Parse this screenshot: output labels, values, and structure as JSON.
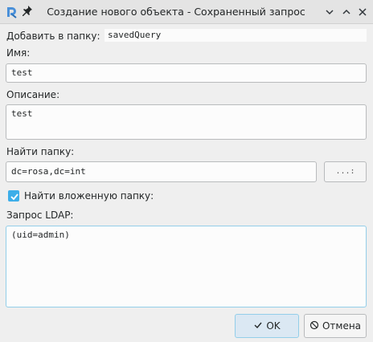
{
  "window": {
    "title": "Создание нового объекта - Сохраненный запрос"
  },
  "form": {
    "add_to_folder_label": "Добавить в папку:",
    "add_to_folder_value": "savedQuery",
    "name_label": "Имя:",
    "name_value": "test",
    "description_label": "Описание:",
    "description_value": "test",
    "search_folder_label": "Найти папку:",
    "search_folder_value": "dc=rosa,dc=int",
    "browse_button_label": "...:",
    "nested_checkbox_label": "Найти вложенную папку:",
    "nested_checked": true,
    "ldap_label": "Запрос LDAP:",
    "ldap_value": "(uid=admin)"
  },
  "buttons": {
    "ok_label": "OK",
    "cancel_label": "Отмена"
  },
  "icons": {
    "app": "app-logo-icon",
    "pin": "pin-icon",
    "minimize": "chevron-down-icon",
    "maximize": "chevron-up-icon",
    "close": "close-icon",
    "ok": "checkmark-icon",
    "cancel": "cancel-icon"
  },
  "colors": {
    "accent": "#3daee9",
    "background": "#efefef"
  }
}
